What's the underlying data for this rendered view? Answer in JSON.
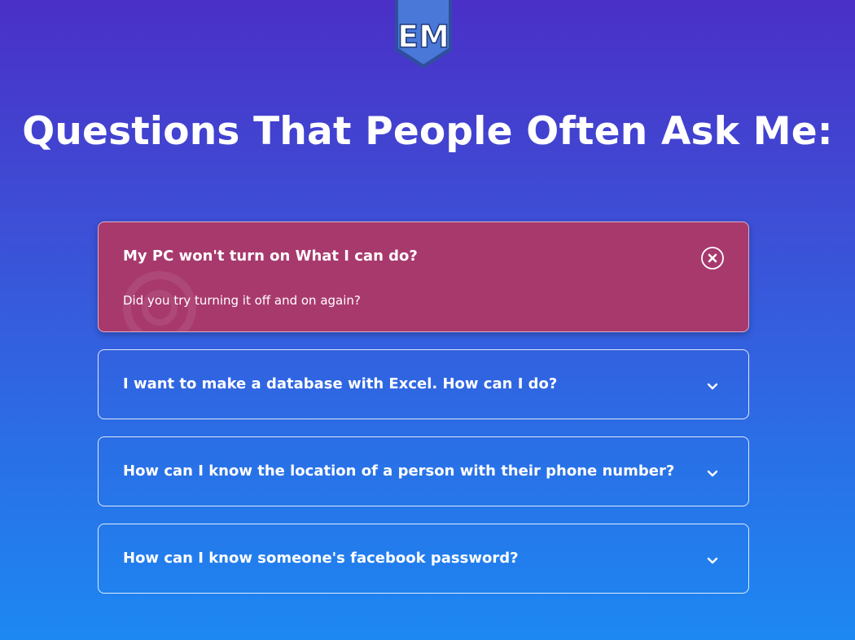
{
  "logo": {
    "letters": "EM",
    "shield_color": "#4a78d8",
    "shield_edge_color": "#2f4f9e"
  },
  "page": {
    "title": "Questions That People Often Ask Me:"
  },
  "colors": {
    "gradient_top": "#4a2fc6",
    "gradient_bottom": "#1d88f2",
    "open_item_background": "#a8396d"
  },
  "faq": {
    "items": [
      {
        "question": "My PC won't turn on What I can do?",
        "answer": "Did you try turning it off and on again?",
        "expanded": true,
        "icon": "close-circle-icon"
      },
      {
        "question": "I want to make a database with Excel. How can I do?",
        "expanded": false,
        "icon": "chevron-down-icon"
      },
      {
        "question": "How can I know the location of a person with their phone number?",
        "expanded": false,
        "icon": "chevron-down-icon"
      },
      {
        "question": "How can I know someone's facebook password?",
        "expanded": false,
        "icon": "chevron-down-icon"
      }
    ]
  }
}
